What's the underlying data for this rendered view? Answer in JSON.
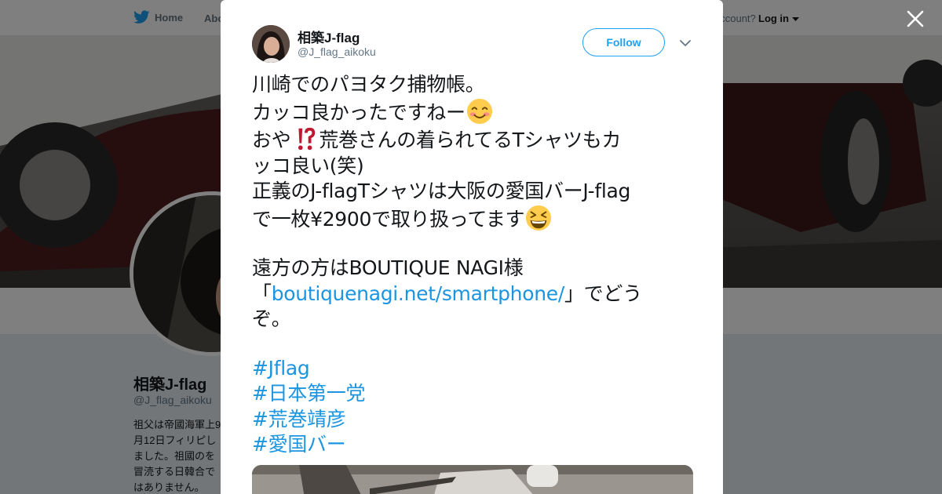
{
  "nav": {
    "home_label": "Home",
    "about_label": "Abo",
    "account_prompt": "account?",
    "login_label": "Log in"
  },
  "profile": {
    "name": "相築J-flag",
    "handle": "@J_flag_aikoku",
    "bio": "祖父は帝國海軍上9月12日フィリピしました。祖國のを冒涜する日韓合ではありません。"
  },
  "tweet": {
    "author_name": "相築J-flag",
    "author_handle": "@J_flag_aikoku",
    "follow_label": "Follow",
    "lines": {
      "l1": "川崎でのパヨタク捕物帳。",
      "l2": "カッコ良かったですねー",
      "l3a": "おや",
      "l3b": "荒巻さんの着られてるTシャツもカ",
      "l4": "ッコ良い(笑)",
      "l5": "正義のJ-flagTシャツは大阪の愛国バーJ-flag",
      "l6": "で一枚¥2900で取り扱ってます",
      "l7": "遠方の方はBOUTIQUE NAGI様",
      "l8a": "「",
      "l8_link": "boutiquenagi.net/smartphone/",
      "l8b": "」でどう",
      "l9": "ぞ。"
    },
    "hashtags": [
      "#Jflag",
      "#日本第一党",
      "#荒巻靖彦",
      "#愛国バー"
    ]
  },
  "colors": {
    "accent": "#1da1f2",
    "link": "#1b95e0",
    "text": "#14171a",
    "muted": "#657786"
  },
  "icons": [
    "twitter-bird-icon",
    "close-icon",
    "chevron-down-icon",
    "smiling-face-emoji",
    "interrobang-emoji",
    "grinning-squinting-face-emoji"
  ]
}
